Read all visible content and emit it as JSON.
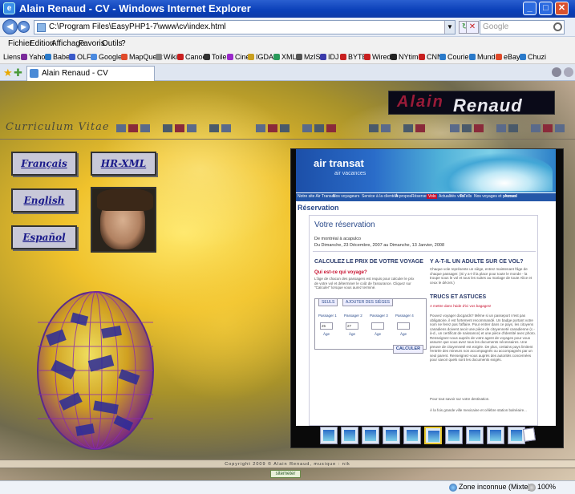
{
  "window": {
    "title": "Alain Renaud - CV - Windows Internet Explorer"
  },
  "address": {
    "url": "C:\\Program Files\\EasyPHP1-7\\www\\cv\\index.html",
    "search_placeholder": "Google"
  },
  "menu": [
    "Fichier",
    "Edition",
    "Affichage",
    "Favoris",
    "Outils",
    "?"
  ],
  "links": {
    "label": "Liens",
    "items": [
      "Yahoo",
      "Babel",
      "OLF",
      "Google",
      "MapQuest",
      "Wiki",
      "Canoe",
      "Toile",
      "Ciné",
      "IGDA",
      "XML",
      "MzIS",
      "IDJ",
      "BYTE",
      "Wired",
      "NYtime",
      "CNN",
      "Courier",
      "Mundo",
      "eBay",
      "Chuzi"
    ]
  },
  "tab": {
    "label": "Alain Renaud - CV"
  },
  "page": {
    "name_first": "Alain",
    "name_last": "Renaud",
    "cv_label": "Curriculum Vitae",
    "lang_buttons": [
      "Français",
      "English",
      "Español"
    ],
    "hrxml_button": "HR-XML",
    "footer": "Copyright 2009 © Alain Renaud, musique : nik",
    "counter": "sitemeter"
  },
  "airtransat": {
    "logo": "air transat",
    "logo_sub": "air vacances",
    "nav": [
      "Notre site Air Transat",
      "Nos voyageurs",
      "Service à la clientèle",
      "À propos",
      "Réserver",
      "Vols",
      "Actualités vols",
      "ToTells",
      "Nos voyages et promos",
      "Accueil"
    ],
    "section": "Réservation",
    "card_title": "Votre réservation",
    "route": "De montréal à acapulco",
    "dates": "Du Dimanche, 23 Décembre, 2007 au Dimanche, 13 Janvier, 2008",
    "calc_heading": "CALCULEZ LE PRIX DE VOTRE VOYAGE",
    "calc_sub": "Qui est-ce qui voyage?",
    "calc_para": "L'âge de chacun des passagers est requis pour calculer le prix de votre vol et déterminer le coût de l'assurance. Cliquez sur \"Calculer\" lorsque vous aurez terminé.",
    "tabs": [
      "SEULS",
      "AJOUTER DES SIÈGES"
    ],
    "passengers": [
      "Passager 1",
      "Passager 2",
      "Passager 3",
      "Passager 4"
    ],
    "ages": [
      "25",
      "27",
      "",
      ""
    ],
    "age_label": "Âge",
    "calc_button": "CALCULER",
    "q_heading": "Y A-T-IL UN ADULTE SUR CE VOL?",
    "q_para": "Chaque vole représente un siège, entrez maintenant l'âge de chaque passager. (Si y a-t-il la place pour toute le monde - la troupe sous le vol et tous les suites au mariage de toute Alice et ceux le décret.)",
    "tips_heading": "TRUCS ET ASTUCES",
    "tips_link": "A mettre dans l'aide d'ici vos bagages!",
    "tips_para": "Pouvez voyager docgards? Même si un passeport n'est pas obligatoire, il est fortement recommandé. Un badge portant votre nom ne ferez pas l'affaire. Pour entrer dans ce pays, les citoyens canadiens doivent avoir une pièce de citoyenneté canadienne (c.-à-d., un certificat de naissance) et une pièce d'identité avec photo. Renseignez-vous auprès de votre agent de voyages pour vous assurer que vous avez tous les documents nécessaires. Une preuve de citoyenneté est exigée. De plus, certains pays limitent l'entrée des mineurs non accompagnés ou accompagnés par un seul parent. Renseignez-vous auprès des autorités concernées pour savoir quels sont les documents exigés.",
    "tips_end": "Pour tout savoir sur votre destination.",
    "tips_more": "À la fois grande ville mexicaine et célèbre station balnéaire..."
  },
  "status": {
    "zone": "Zone inconnue (Mixte)",
    "zoom": "100%"
  },
  "colors": {
    "name_first": "#9a1b38",
    "name_last": "#e8e8ee",
    "lang_text": "#1a1a8a",
    "title_bar": "#0a3fb8"
  }
}
